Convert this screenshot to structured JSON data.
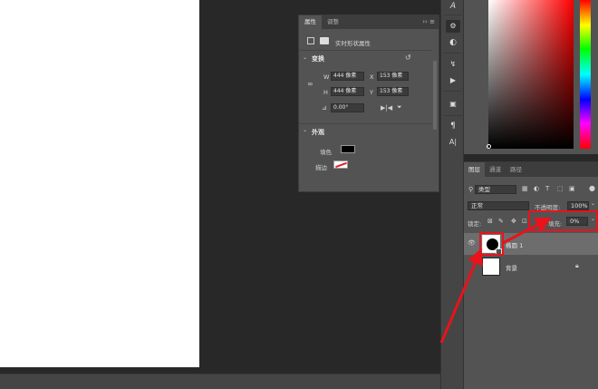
{
  "properties_panel": {
    "tabs": [
      "属性",
      "调整"
    ],
    "menu_icon": "panel-menu-icon",
    "subtitle": "实时形状属性",
    "transform": {
      "heading": "变换",
      "w_label": "W",
      "w_value": "444 像素",
      "x_label": "X",
      "x_value": "153 像素",
      "h_label": "H",
      "h_value": "444 像素",
      "y_label": "Y",
      "y_value": "153 像素",
      "angle_value": "0.00°"
    },
    "appearance": {
      "heading": "外观",
      "fill_label": "填色",
      "fill_color": "#000000",
      "stroke_label": "描边"
    }
  },
  "tools": [
    "A",
    "¶",
    "A|"
  ],
  "layers_panel": {
    "tabs": [
      "图层",
      "通道",
      "路径"
    ],
    "filter_value": "类型",
    "blend_mode": "正常",
    "opacity_label": "不透明度:",
    "opacity_value": "100%",
    "lock_label": "锁定:",
    "fill_label": "填充:",
    "fill_value": "0%",
    "layers": [
      {
        "name": "椭圆 1",
        "visible": true,
        "selected": true
      },
      {
        "name": "背景",
        "visible": false,
        "selected": false,
        "locked": true
      }
    ]
  },
  "colors": {
    "highlight": "#e8131b",
    "panel_bg": "#535353",
    "canvas_bg": "#282828"
  }
}
